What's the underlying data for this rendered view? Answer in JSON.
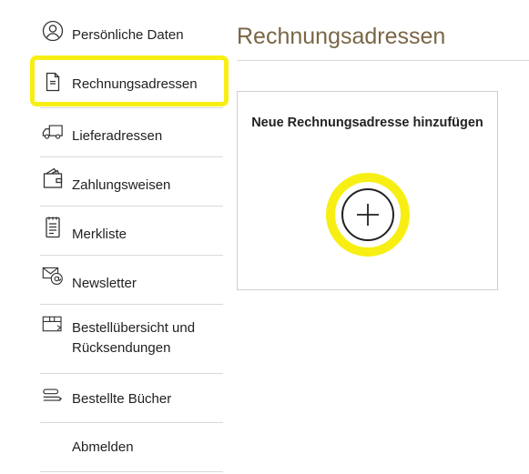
{
  "sidebar": {
    "items": [
      {
        "label": "Persönliche Daten",
        "icon": "person-icon"
      },
      {
        "label": "Rechnungsadressen",
        "icon": "document-icon"
      },
      {
        "label": "Lieferadressen",
        "icon": "truck-icon"
      },
      {
        "label": "Zahlungsweisen",
        "icon": "wallet-icon"
      },
      {
        "label": "Merkliste",
        "icon": "list-icon"
      },
      {
        "label": "Newsletter",
        "icon": "mail-at-icon"
      },
      {
        "label": "Bestellübersicht und Rücksendungen",
        "icon": "box-icon"
      },
      {
        "label": "Bestellte Bücher",
        "icon": "books-icon"
      },
      {
        "label": "Abmelden",
        "icon": ""
      }
    ],
    "active_index": 1
  },
  "main": {
    "title": "Rechnungsadressen",
    "card": {
      "heading": "Neue Rechnungsadresse hinzufügen",
      "add_icon": "plus-circle-icon"
    }
  },
  "colors": {
    "title": "#7a6646",
    "highlight": "#f7ef14",
    "divider": "#d9d9d9",
    "text": "#222222"
  }
}
